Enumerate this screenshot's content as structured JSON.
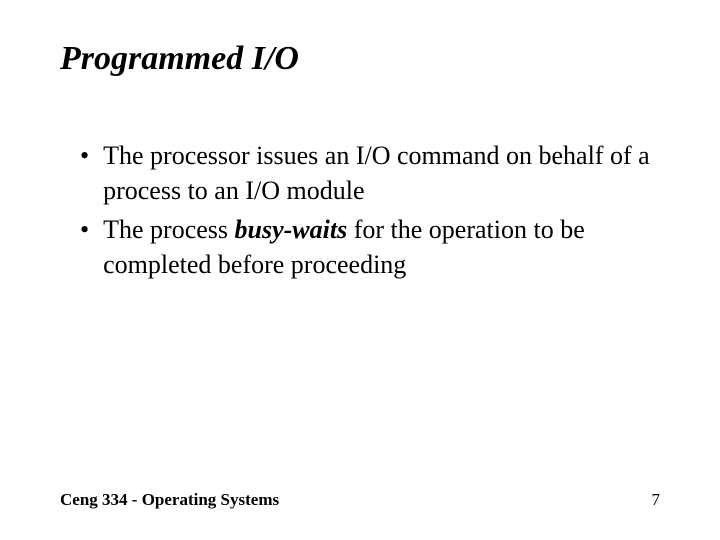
{
  "slide": {
    "title": "Programmed I/O",
    "bullets": [
      {
        "text_before": "The processor issues an I/O command on behalf of a process to an I/O module",
        "emphasis": "",
        "text_after": ""
      },
      {
        "text_before": "The process ",
        "emphasis": "busy-waits",
        "text_after": " for the operation to be completed before proceeding"
      }
    ],
    "footer": {
      "left": "Ceng 334 - Operating Systems",
      "page_number": "7"
    }
  }
}
